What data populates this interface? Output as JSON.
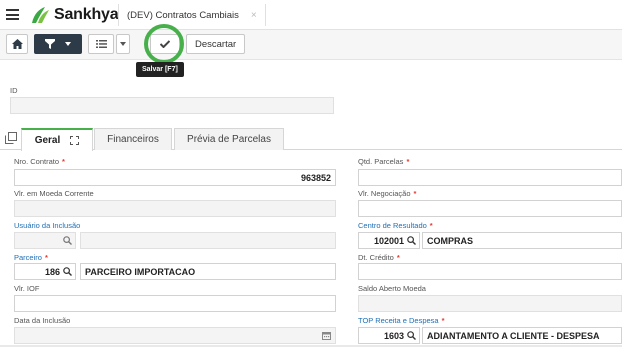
{
  "app": {
    "brand": "Sankhya"
  },
  "tab": {
    "title": "(DEV) Contratos Cambiais",
    "close": "×"
  },
  "toolbar": {
    "discard_label": "Descartar",
    "save_tooltip": "Salvar [F7]"
  },
  "header_fields": {
    "id_label": "ID",
    "id_value": ""
  },
  "tabs": {
    "items": [
      {
        "label": "Geral"
      },
      {
        "label": "Financeiros"
      },
      {
        "label": "Prévia de Parcelas"
      }
    ]
  },
  "form": {
    "nro_contrato": {
      "label": "Nro. Contrato",
      "value": "963852",
      "required": "*"
    },
    "vlr_moeda_corrente": {
      "label": "Vlr. em Moeda Corrente",
      "value": ""
    },
    "usuario_inclusao": {
      "label": "Usuário da Inclusão",
      "code": "",
      "name": ""
    },
    "parceiro": {
      "label": "Parceiro",
      "code": "186",
      "name": "PARCEIRO IMPORTACAO",
      "required": "*"
    },
    "vlr_iof": {
      "label": "Vlr. IOF",
      "value": ""
    },
    "data_inclusao": {
      "label": "Data da Inclusão",
      "value": ""
    },
    "qtd_parcelas": {
      "label": "Qtd. Parcelas",
      "value": "",
      "required": "*"
    },
    "vlr_negociacao": {
      "label": "Vlr. Negociação",
      "value": "",
      "required": "*"
    },
    "centro_resultado": {
      "label": "Centro de Resultado",
      "code": "102001",
      "name": "COMPRAS",
      "required": "*"
    },
    "dt_credito": {
      "label": "Dt. Crédito",
      "value": "",
      "required": "*"
    },
    "saldo_aberto_moeda": {
      "label": "Saldo Aberto Moeda",
      "value": ""
    },
    "top_receita_despesa": {
      "label": "TOP Receita e Despesa",
      "code": "1603",
      "name": "ADIANTAMENTO A CLIENTE - DESPESA",
      "required": "*"
    }
  },
  "colors": {
    "accent": "#47b04b",
    "link_blue": "#1f6fb5",
    "dark_button": "#2d3a47",
    "required": "#e53935"
  },
  "icons": [
    "menu-icon",
    "sankhya-logo-icon",
    "home-icon",
    "filter-icon",
    "list-icon",
    "chevron-down-icon",
    "check-icon",
    "copy-icon",
    "expand-icon",
    "search-icon",
    "calendar-icon"
  ]
}
